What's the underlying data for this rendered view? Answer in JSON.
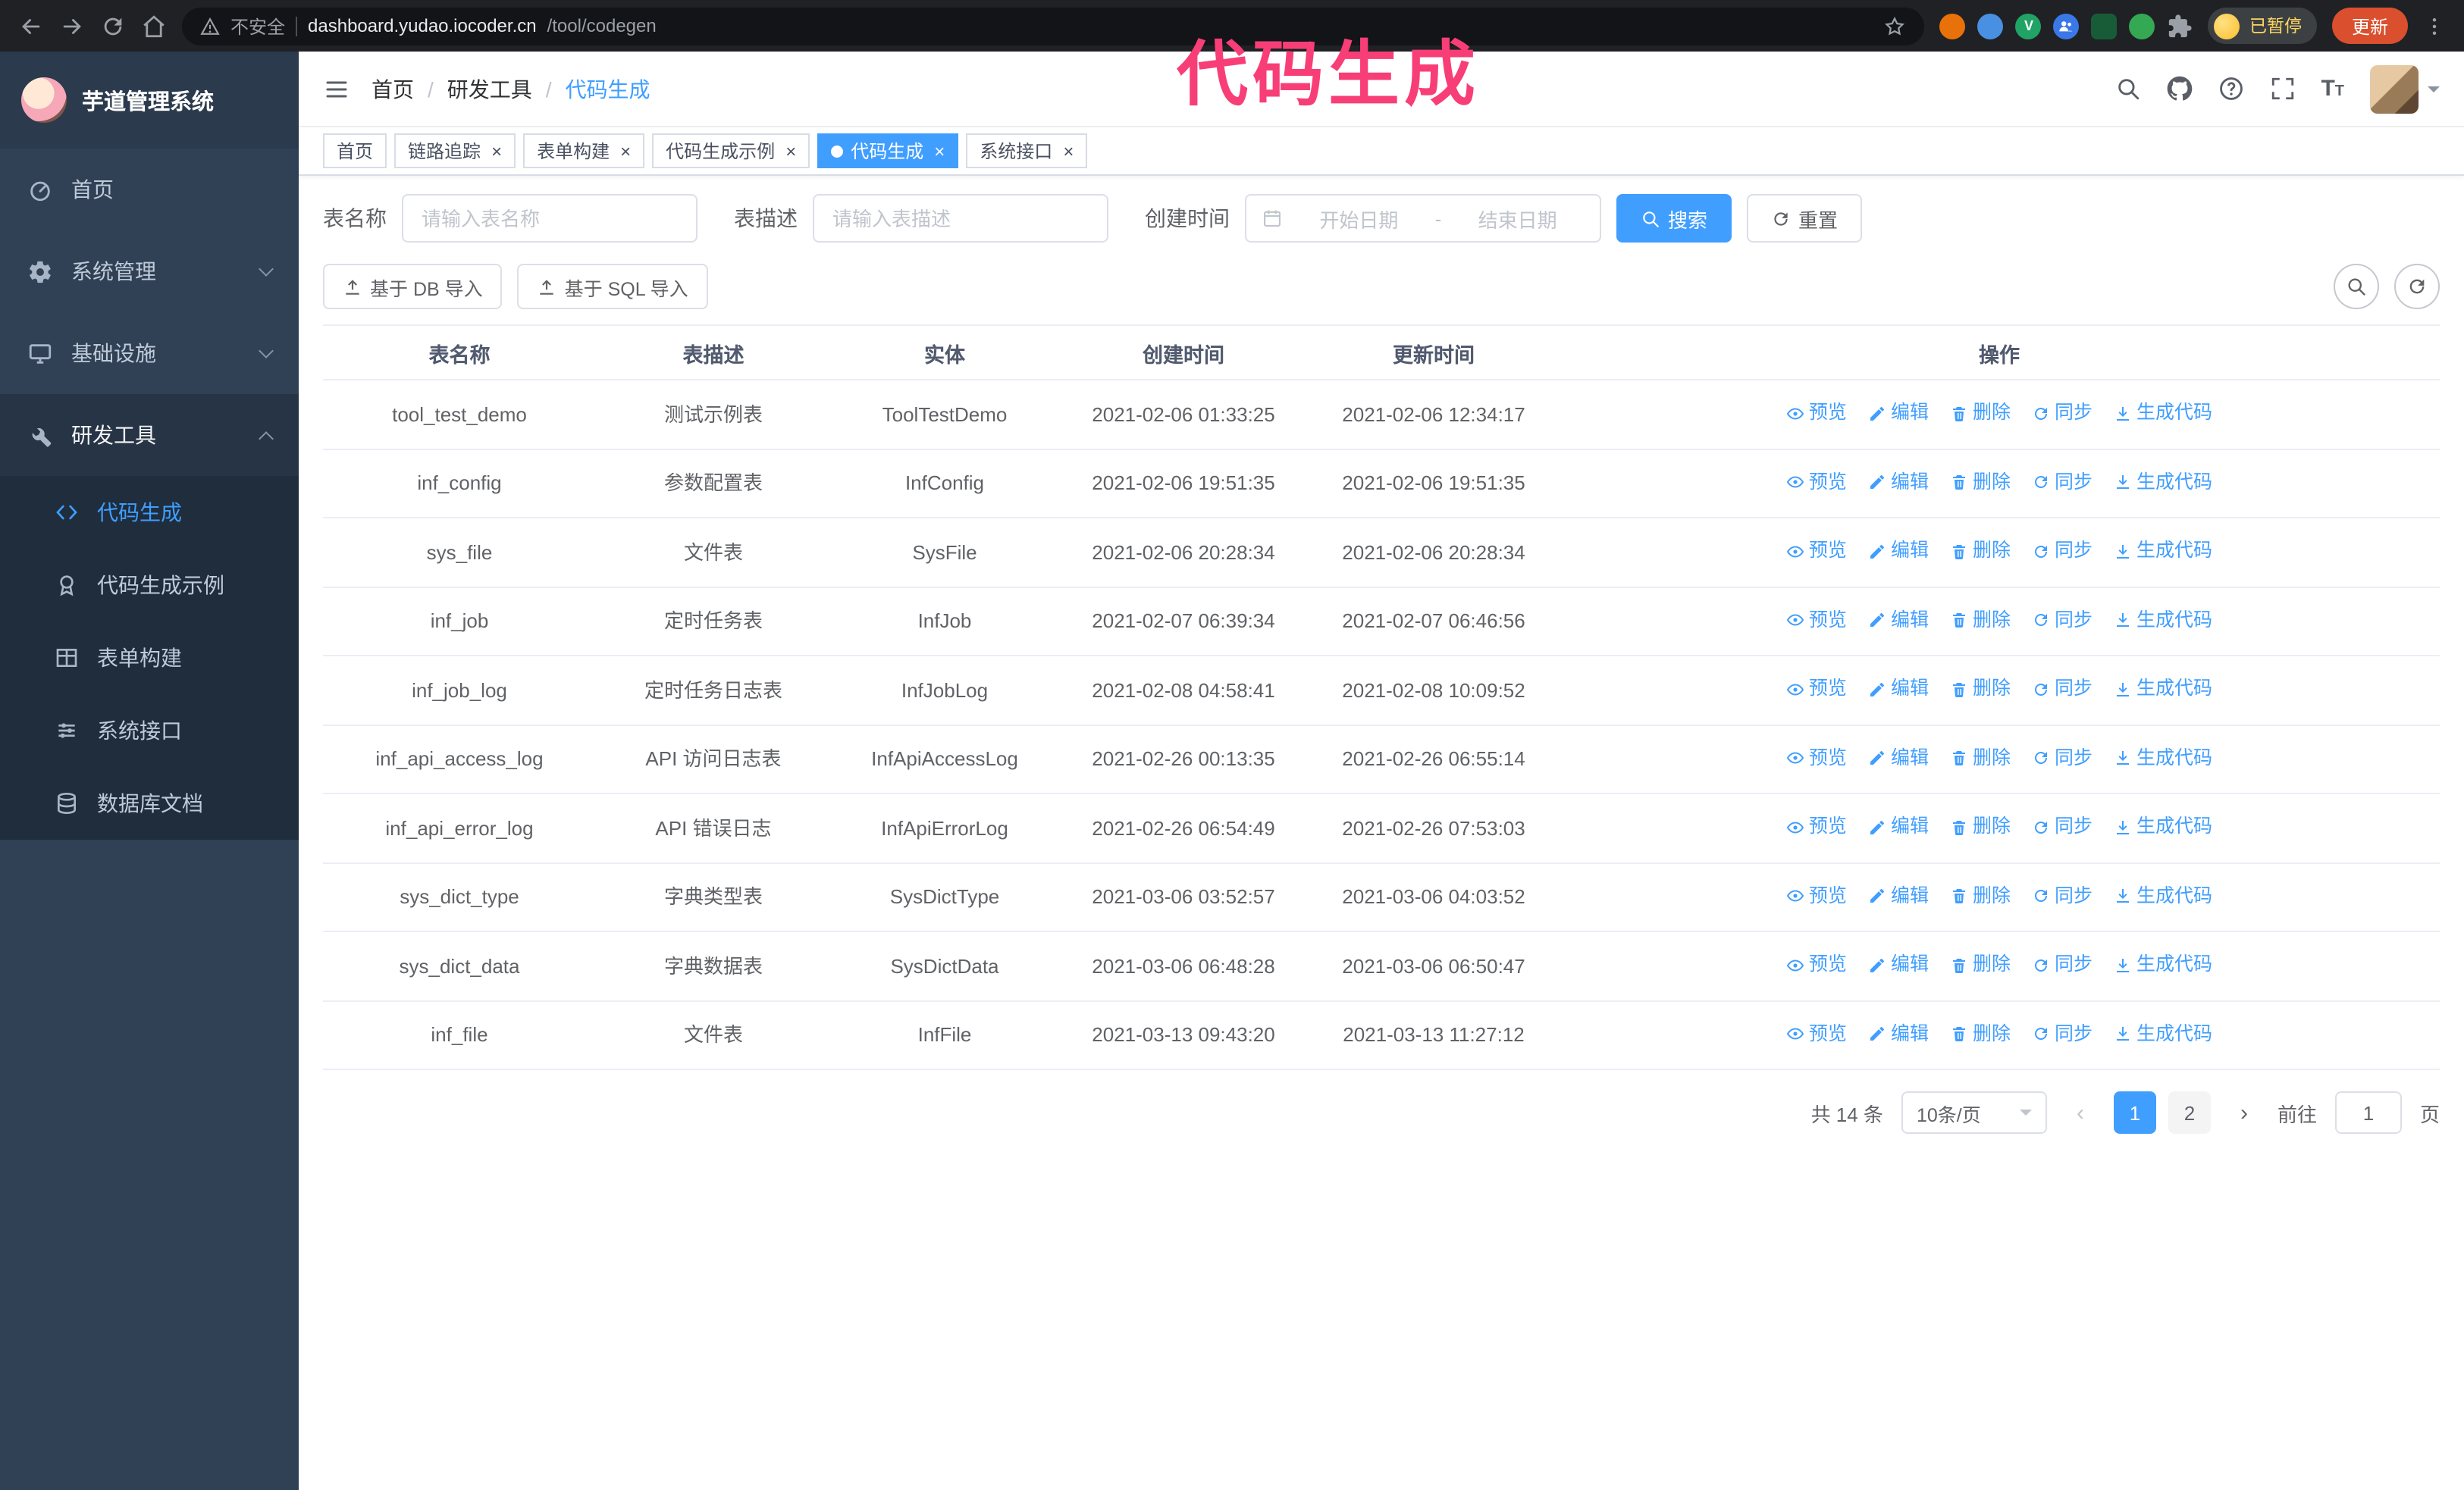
{
  "browser": {
    "security_label": "不安全",
    "url_host": "dashboard.yudao.iocoder.cn",
    "url_path": "/tool/codegen",
    "paused_badge": "已暂停",
    "update_button": "更新"
  },
  "annotation": {
    "text": "代码生成",
    "color": "#f83e77"
  },
  "sidebar": {
    "logo_title": "芋道管理系统",
    "items": [
      {
        "key": "home",
        "label": "首页",
        "icon": "dashboard-icon",
        "expandable": false,
        "expanded": false
      },
      {
        "key": "system",
        "label": "系统管理",
        "icon": "gear-icon",
        "expandable": true,
        "expanded": false
      },
      {
        "key": "infra",
        "label": "基础设施",
        "icon": "infra-icon",
        "expandable": true,
        "expanded": false
      },
      {
        "key": "devtools",
        "label": "研发工具",
        "icon": "tools-icon",
        "expandable": true,
        "expanded": true
      }
    ],
    "subitems": [
      {
        "key": "codegen",
        "label": "代码生成",
        "icon": "code-icon",
        "active": true
      },
      {
        "key": "codegen-demo",
        "label": "代码生成示例",
        "icon": "badge-icon",
        "active": false
      },
      {
        "key": "form-builder",
        "label": "表单构建",
        "icon": "form-icon",
        "active": false
      },
      {
        "key": "api",
        "label": "系统接口",
        "icon": "api-icon",
        "active": false
      },
      {
        "key": "db-doc",
        "label": "数据库文档",
        "icon": "db-icon",
        "active": false
      }
    ]
  },
  "header": {
    "breadcrumb": [
      "首页",
      "研发工具",
      "代码生成"
    ]
  },
  "tabs": [
    {
      "label": "首页",
      "closable": false,
      "active": false
    },
    {
      "label": "链路追踪",
      "closable": true,
      "active": false
    },
    {
      "label": "表单构建",
      "closable": true,
      "active": false
    },
    {
      "label": "代码生成示例",
      "closable": true,
      "active": false
    },
    {
      "label": "代码生成",
      "closable": true,
      "active": true
    },
    {
      "label": "系统接口",
      "closable": true,
      "active": false
    }
  ],
  "filters": {
    "table_name_label": "表名称",
    "table_name_placeholder": "请输入表名称",
    "table_desc_label": "表描述",
    "table_desc_placeholder": "请输入表描述",
    "create_time_label": "创建时间",
    "date_start_placeholder": "开始日期",
    "date_separator": "-",
    "date_end_placeholder": "结束日期",
    "search_button": "搜索",
    "reset_button": "重置"
  },
  "toolbar": {
    "import_db": "基于 DB 导入",
    "import_sql": "基于 SQL 导入"
  },
  "table": {
    "columns": [
      "表名称",
      "表描述",
      "实体",
      "创建时间",
      "更新时间",
      "操作"
    ],
    "actions": [
      "预览",
      "编辑",
      "删除",
      "同步",
      "生成代码"
    ],
    "rows": [
      {
        "name": "tool_test_demo",
        "desc": "测试示例表",
        "entity": "ToolTestDemo",
        "create_time": "2021-02-06 01:33:25",
        "update_time": "2021-02-06 12:34:17"
      },
      {
        "name": "inf_config",
        "desc": "参数配置表",
        "entity": "InfConfig",
        "create_time": "2021-02-06 19:51:35",
        "update_time": "2021-02-06 19:51:35"
      },
      {
        "name": "sys_file",
        "desc": "文件表",
        "entity": "SysFile",
        "create_time": "2021-02-06 20:28:34",
        "update_time": "2021-02-06 20:28:34"
      },
      {
        "name": "inf_job",
        "desc": "定时任务表",
        "entity": "InfJob",
        "create_time": "2021-02-07 06:39:34",
        "update_time": "2021-02-07 06:46:56"
      },
      {
        "name": "inf_job_log",
        "desc": "定时任务日志表",
        "entity": "InfJobLog",
        "create_time": "2021-02-08 04:58:41",
        "update_time": "2021-02-08 10:09:52"
      },
      {
        "name": "inf_api_access_log",
        "desc": "API 访问日志表",
        "entity": "InfApiAccessLog",
        "create_time": "2021-02-26 00:13:35",
        "update_time": "2021-02-26 06:55:14"
      },
      {
        "name": "inf_api_error_log",
        "desc": "API 错误日志",
        "entity": "InfApiErrorLog",
        "create_time": "2021-02-26 06:54:49",
        "update_time": "2021-02-26 07:53:03"
      },
      {
        "name": "sys_dict_type",
        "desc": "字典类型表",
        "entity": "SysDictType",
        "create_time": "2021-03-06 03:52:57",
        "update_time": "2021-03-06 04:03:52"
      },
      {
        "name": "sys_dict_data",
        "desc": "字典数据表",
        "entity": "SysDictData",
        "create_time": "2021-03-06 06:48:28",
        "update_time": "2021-03-06 06:50:47"
      },
      {
        "name": "inf_file",
        "desc": "文件表",
        "entity": "InfFile",
        "create_time": "2021-03-13 09:43:20",
        "update_time": "2021-03-13 11:27:12"
      }
    ]
  },
  "pagination": {
    "total_text": "共 14 条",
    "page_size": "10条/页",
    "pages": [
      "1",
      "2"
    ],
    "active_page": "1",
    "goto_label": "前往",
    "goto_value": "1",
    "goto_suffix": "页"
  },
  "colors": {
    "primary": "#409eff",
    "sidebar_bg": "#304156",
    "annotation": "#f83e77"
  }
}
